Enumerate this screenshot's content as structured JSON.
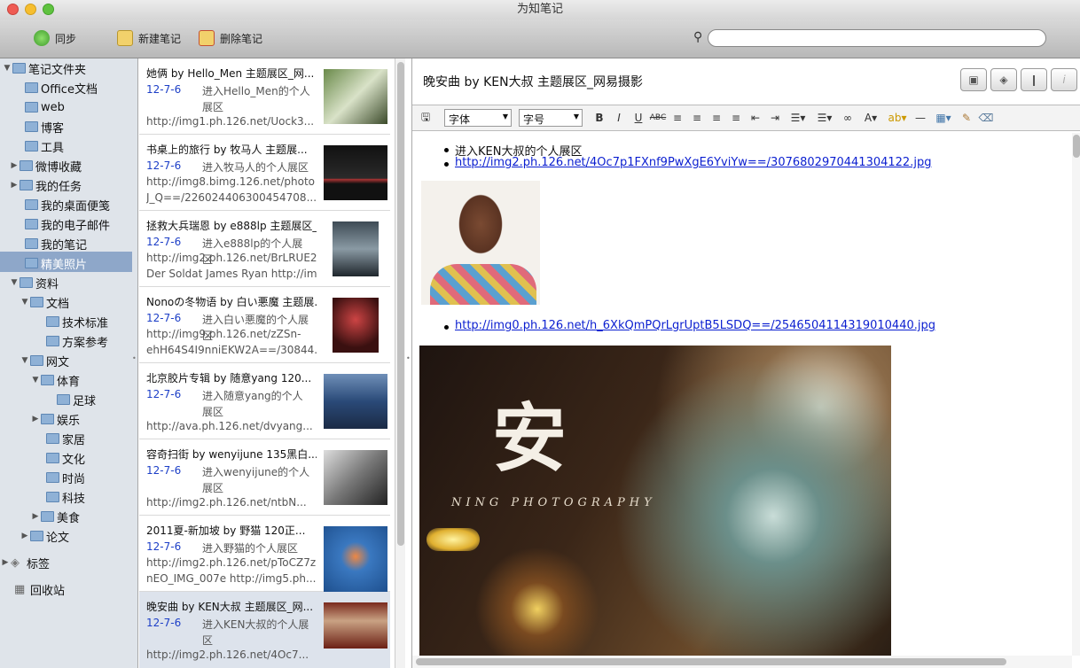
{
  "window": {
    "title": "为知笔记"
  },
  "toolbar": {
    "sync": "同步",
    "new_note": "新建笔记",
    "delete_note": "删除笔记",
    "search_placeholder": ""
  },
  "sidebar": {
    "items": [
      {
        "label": "笔记文件夹"
      },
      {
        "label": "Office文档"
      },
      {
        "label": "web"
      },
      {
        "label": "博客"
      },
      {
        "label": "工具"
      },
      {
        "label": "微博收藏"
      },
      {
        "label": "我的任务"
      },
      {
        "label": "我的桌面便笺"
      },
      {
        "label": "我的电子邮件"
      },
      {
        "label": "我的笔记"
      },
      {
        "label": "精美照片"
      },
      {
        "label": "资料"
      },
      {
        "label": "文档"
      },
      {
        "label": "技术标准"
      },
      {
        "label": "方案参考"
      },
      {
        "label": "网文"
      },
      {
        "label": "体育"
      },
      {
        "label": "足球"
      },
      {
        "label": "娱乐"
      },
      {
        "label": "家居"
      },
      {
        "label": "文化"
      },
      {
        "label": "时尚"
      },
      {
        "label": "科技"
      },
      {
        "label": "美食"
      },
      {
        "label": "论文"
      },
      {
        "label": "标签"
      },
      {
        "label": "回收站"
      }
    ]
  },
  "notes": [
    {
      "title": "她俩 by Hello_Men 主题展区_网...",
      "date": "12-7-6",
      "summary": "进入Hello_Men的个人展区",
      "url": "http://img1.ph.126.net/Uock3..."
    },
    {
      "title": "书桌上的旅行 by 牧马人 主题展...",
      "date": "12-7-6",
      "summary": "进入牧马人的个人展区",
      "url": "http://img8.bimg.126.net/photo",
      "url2": "J_Q==/226024406300454708..."
    },
    {
      "title": "拯救大兵瑞恩 by e888lp 主题展区_...",
      "date": "12-7-6",
      "summary": "进入e888lp的个人展区",
      "url": "http://img2.ph.126.net/BrLRUE2yL",
      "url2": "Der Soldat James Ryan http://im..."
    },
    {
      "title": "Nonoの冬物语 by 白い悪魔 主题展...",
      "date": "12-7-6",
      "summary": "进入白い悪魔的个人展区",
      "url": "http://img9.ph.126.net/zZSn-",
      "url2": "ehH64S4I9nniEKW2A==/30844..."
    },
    {
      "title": "北京胶片专辑 by 随意yang 120...",
      "date": "12-7-6",
      "summary": "进入随意yang的个人展区",
      "url": "http://ava.ph.126.net/dvyang..."
    },
    {
      "title": "容奇扫街 by wenyijune 135黑白...",
      "date": "12-7-6",
      "summary": "进入wenyijune的个人展区",
      "url": "http://img2.ph.126.net/ntbN..."
    },
    {
      "title": "2011夏-新加坡 by 野猫 120正...",
      "date": "12-7-6",
      "summary": "进入野猫的个人展区",
      "url": "http://img2.ph.126.net/pToCZ7z",
      "url2": "nEO_IMG_007e http://img5.ph..."
    },
    {
      "title": "晚安曲 by KEN大叔 主题展区_网...",
      "date": "12-7-6",
      "summary": "进入KEN大叔的个人展区",
      "url": "http://img2.ph.126.net/4Oc7..."
    }
  ],
  "editor": {
    "title": "晚安曲 by KEN大叔 主题展区_网易摄影",
    "font_label": "字体",
    "size_label": "字号",
    "item1": "进入KEN大叔的个人展区",
    "link1": "http://img2.ph.126.net/4Oc7p1FXnf9PwXgE6YviYw==/3076802970441304122.jpg",
    "link2": "http://img0.ph.126.net/h_6XkQmPQrLgrUptB5LSDQ==/2546504114319010440.jpg",
    "photo_char": "安",
    "photo_caption": "NING PHOTOGRAPHY"
  }
}
